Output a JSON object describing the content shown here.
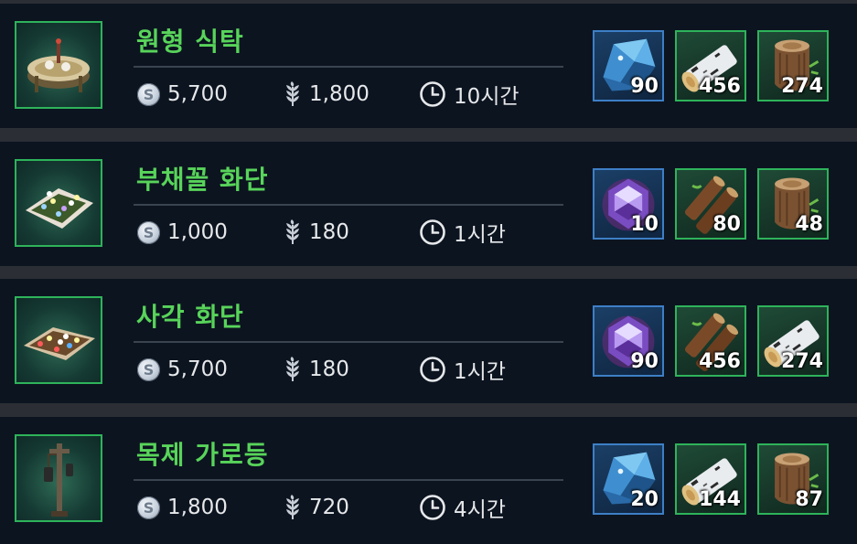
{
  "recipes": [
    {
      "name": "원형 식탁",
      "thumb_icon": "round-table-icon",
      "silver": "5,700",
      "grain": "1,800",
      "time": "10시간",
      "materials": [
        {
          "icon": "blue-crystal-icon",
          "qty": "90"
        },
        {
          "icon": "birch-log-icon",
          "qty": "456"
        },
        {
          "icon": "tree-stump-icon",
          "qty": "274"
        }
      ]
    },
    {
      "name": "부채꼴 화단",
      "thumb_icon": "fan-flowerbed-icon",
      "silver": "1,000",
      "grain": "180",
      "time": "1시간",
      "materials": [
        {
          "icon": "purple-gem-icon",
          "qty": "10"
        },
        {
          "icon": "oak-log-icon",
          "qty": "80"
        },
        {
          "icon": "tree-stump-icon",
          "qty": "48"
        }
      ]
    },
    {
      "name": "사각 화단",
      "thumb_icon": "square-flowerbed-icon",
      "silver": "5,700",
      "grain": "180",
      "time": "1시간",
      "materials": [
        {
          "icon": "purple-gem-icon",
          "qty": "90"
        },
        {
          "icon": "oak-log-icon",
          "qty": "456"
        },
        {
          "icon": "birch-log-icon",
          "qty": "274"
        }
      ]
    },
    {
      "name": "목제 가로등",
      "thumb_icon": "wooden-streetlamp-icon",
      "silver": "1,800",
      "grain": "720",
      "time": "4시간",
      "materials": [
        {
          "icon": "blue-crystal-icon",
          "qty": "20"
        },
        {
          "icon": "birch-log-icon",
          "qty": "144"
        },
        {
          "icon": "tree-stump-icon",
          "qty": "87"
        }
      ]
    }
  ],
  "colors": {
    "panel": "#0c1420",
    "name_green": "#58d45a",
    "frame_green": "#2eb35a",
    "frame_blue": "#3d7fc6"
  }
}
